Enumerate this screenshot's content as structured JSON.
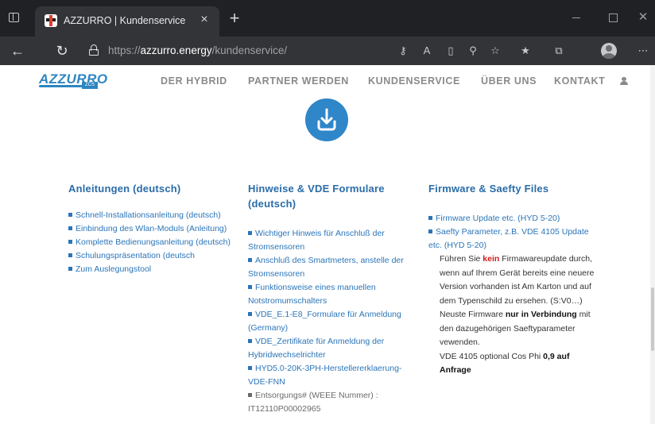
{
  "browser": {
    "tab_title": "AZZURRO | Kundenservice",
    "tab_close": "×",
    "new_tab": "+",
    "url_prefix": "https://",
    "url_host": "azzurro.energy",
    "url_path": "/kundenservice/",
    "window_controls": {
      "minimize": "",
      "maximize": "",
      "close": "✕"
    }
  },
  "site": {
    "logo_text": "AZZURRO",
    "logo_tag": "ZCS",
    "nav": [
      "DER HYBRID",
      "PARTNER WERDEN",
      "KUNDENSERVICE",
      "ÜBER UNS",
      "KONTAKT"
    ],
    "accent_color": "#2b75b8"
  },
  "columns": {
    "anleitungen": {
      "title": "Anleitungen (deutsch)",
      "items": [
        "Schnell-Installationsanleitung (deutsch)",
        "Einbindung des Wlan-Moduls (Anleitung)",
        "Komplette Bedienungsanleitung (deutsch)",
        "Schulungspräsentation (deutsch",
        "Zum Auslegungstool"
      ]
    },
    "hinweise": {
      "title": "Hinweise  & VDE Formulare (deutsch)",
      "items": [
        "Wichtiger Hinweis für Anschluß der Stromsensoren",
        "Anschluß des Smartmeters, anstelle der Stromsensoren",
        "Funktionsweise eines manuellen Notstromumschalters",
        "VDE_E.1-E8_Formulare für Anmeldung (Germany)",
        "VDE_Zertifikate für Anmeldung der Hybridwechselrichter",
        "HYD5.0-20K-3PH-Herstellererklaerung-VDE-FNN"
      ],
      "weee": "Entsorgungs# (WEEE Nummer) : IT12110P00002965"
    },
    "firmware": {
      "title": "Firmware & Saefty Files",
      "items": [
        "Firmware Update etc. (HYD 5-20)",
        "Saefty Parameter, z.B. VDE 4105 Update etc. (HYD 5-20)"
      ],
      "note_1a": "Führen Sie ",
      "note_1b": "kein",
      "note_1c": " Firmawareupdate durch, wenn auf Ihrem Gerät bereits eine neuere Version vorhanden ist Am Karton und auf dem Typenschild zu ersehen. (S:V0…)",
      "note_2a": "Neuste Firmware ",
      "note_2b": "nur in Verbindung",
      "note_2c": " mit den dazugehörigen Saeftyparameter vewenden.",
      "note_3a": "VDE 4105 optional Cos Phi ",
      "note_3b": "0,9 auf Anfrage"
    }
  }
}
